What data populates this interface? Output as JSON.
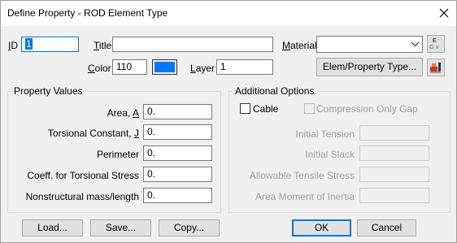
{
  "window": {
    "title": "Define Property - ROD Element Type"
  },
  "top": {
    "id_label": "ID",
    "id_value": "1",
    "title_label": "Title",
    "title_value": "",
    "material_label": "Material",
    "material_value": "",
    "color_label": "Color",
    "color_value": "110",
    "color_swatch": "#0078ff",
    "layer_label": "Layer",
    "layer_value": "1",
    "elem_type_button": "Elem/Property Type..."
  },
  "property_values": {
    "title": "Property Values",
    "fields": [
      {
        "label": "Area,",
        "suffix": "A",
        "value": "0."
      },
      {
        "label": "Torsional Constant,",
        "suffix": "J",
        "value": "0."
      },
      {
        "label": "Perimeter",
        "suffix": "",
        "value": "0."
      },
      {
        "label": "Coeff. for Torsional Stress",
        "suffix": "",
        "value": "0."
      },
      {
        "label": "Nonstructural mass/length",
        "suffix": "",
        "value": "0."
      }
    ]
  },
  "additional_options": {
    "title": "Additional Options",
    "cable_label": "Cable",
    "cable_checked": false,
    "compression_label": "Compression Only Gap",
    "compression_checked": false,
    "fields": [
      {
        "label": "Initial Tension",
        "value": ""
      },
      {
        "label": "Initial Slack",
        "value": ""
      },
      {
        "label": "Allowable Tensile Stress",
        "value": ""
      },
      {
        "label": "Area Moment of Inertia",
        "value": ""
      }
    ]
  },
  "buttons": {
    "load": "Load...",
    "save": "Save...",
    "copy": "Copy...",
    "ok": "OK",
    "cancel": "Cancel"
  }
}
